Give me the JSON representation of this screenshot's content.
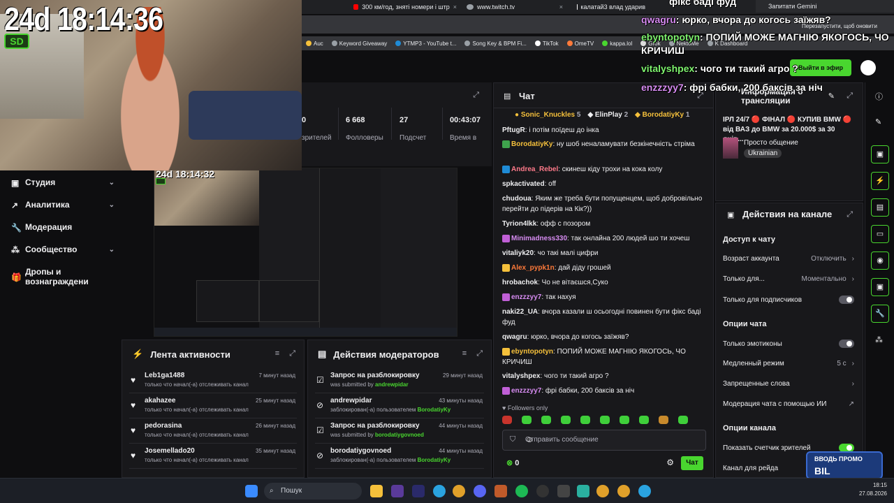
{
  "browser": {
    "tabs": [
      {
        "label": "300 км/год, зняті номери і штр",
        "color": "#ff0000"
      },
      {
        "label": "www.twitch.tv",
        "color": "#9aa0a6"
      },
      {
        "label": "калатай3 влад ударив",
        "color": "#ffffff"
      }
    ],
    "tab_close": "×",
    "win_buttons": [
      "—",
      "❐",
      "✕"
    ],
    "gemini": "Запитати Gemini",
    "restart": "Перезапустити, щоб оновити",
    "bookmarks": [
      "Auc",
      "Keyword Giveaway",
      "YTMP3 - YouTube t...",
      "Song Key & BPM Fi...",
      "TikTok",
      "OmeTV",
      "kappa.lol",
      "Grok",
      "NektoMe",
      "K Dashboard"
    ]
  },
  "stream": {
    "timer": "24d 18:14:36",
    "badge": "SD",
    "preview_timer": "24d 18:14:32"
  },
  "stats": {
    "items": [
      {
        "value": "0",
        "label": "зрителей"
      },
      {
        "value": "6 668",
        "label": "Фолловеры"
      },
      {
        "value": "27",
        "label": "Подсчет"
      },
      {
        "value": "00:43:07",
        "label": "Время в"
      }
    ]
  },
  "sidebar": {
    "items": [
      {
        "label": "Студия",
        "chevron": "⌄"
      },
      {
        "label": "Аналитика",
        "chevron": "⌄"
      },
      {
        "label": "Модерация",
        "chevron": ""
      },
      {
        "label": "Сообщество",
        "chevron": "⌄"
      },
      {
        "label": "Дропы и вознаграждени",
        "chevron": ""
      }
    ]
  },
  "activity": {
    "title": "Лента активности",
    "rows": [
      {
        "name": "Leb1ga1488",
        "sub": "только что начал(-а) отслеживать канал",
        "time": "7 минут назад"
      },
      {
        "name": "akahazee",
        "sub": "только что начал(-а) отслеживать канал",
        "time": "25 минут назад"
      },
      {
        "name": "pedorasina",
        "sub": "только что начал(-а) отслеживать канал",
        "time": "26 минут назад"
      },
      {
        "name": "Josemellado20",
        "sub": "только что начал(-а) отслеживать канал",
        "time": "35 минут назад"
      }
    ]
  },
  "modactions": {
    "title": "Действия модераторов",
    "rows": [
      {
        "name": "Запрос на разблокировку",
        "sub_prefix": "was submitted by",
        "sub_user": "andrewpidar",
        "time": "29 минут назад"
      },
      {
        "name": "andrewpidar",
        "sub_prefix": "заблокирован(-а) пользователем",
        "sub_user": "BorodatiyKy",
        "time": "43 минуты назад"
      },
      {
        "name": "Запрос на разблокировку",
        "sub_prefix": "was submitted by",
        "sub_user": "borodatiygovnoed",
        "time": "44 минуты назад"
      },
      {
        "name": "borodatiygovnoed",
        "sub_prefix": "заблокирован(-а) пользователем",
        "sub_user": "BorodatiyKy",
        "time": "44 минуты назад"
      }
    ]
  },
  "chat": {
    "title": "Чат",
    "gifters": [
      {
        "name": "Sonic_Knuckles",
        "count": "5",
        "color": "#f5c03b"
      },
      {
        "name": "ElinPlay",
        "count": "2",
        "color": "#efeff1"
      },
      {
        "name": "BorodatiyKy",
        "count": "1",
        "color": "#f5c03b"
      }
    ],
    "messages": [
      {
        "user": "PftugR",
        "color": "#efeff1",
        "text": ": і потім поїдеш до інка",
        "badge": ""
      },
      {
        "user": "BorodatiyKy",
        "color": "#f5c03b",
        "text": ": ну шоб неналамувати безкінечність стріма",
        "badge": "#3fa34d"
      },
      {
        "user": "Andrea_Rebel",
        "color": "#ff7a8a",
        "text": ": скинеш кіду трохи на кока колу",
        "badge": "#1f8bd6"
      },
      {
        "user": "spkactivated",
        "color": "#efeff1",
        "text": ": off",
        "badge": ""
      },
      {
        "user": "chudoua",
        "color": "#efeff1",
        "text": ": Яким же треба бути попущенцем, щоб добровільно перейти до підерів на Кік?))",
        "badge": ""
      },
      {
        "user": "Tyrion4lkk",
        "color": "#efeff1",
        "text": ": офф с позором",
        "badge": ""
      },
      {
        "user": "Minimadness330",
        "color": "#d78cf2",
        "text": ": так онлайна 200 людей шо ти хочеш",
        "badge": "#c05fd6"
      },
      {
        "user": "vitaliyk20",
        "color": "#efeff1",
        "text": ": чо такі малі цифри",
        "badge": ""
      },
      {
        "user": "Alex_pypk1n",
        "color": "#ff7a3a",
        "text": ": дай діду грошей",
        "badge": "#f5c03b"
      },
      {
        "user": "hrobachok",
        "color": "#efeff1",
        "text": ": Чо не вітаєшся,Суко",
        "badge": ""
      },
      {
        "user": "enzzzyy7",
        "color": "#d78cf2",
        "text": ": так нахуя",
        "badge": "#c05fd6"
      },
      {
        "user": "naki22_UA",
        "color": "#efeff1",
        "text": ": вчора казали ш осьогодні повинен бути фікс баді фуд",
        "badge": ""
      },
      {
        "user": "qwagru",
        "color": "#efeff1",
        "text": ": юрко, вчора до когось заїжяв?",
        "badge": ""
      },
      {
        "user": "ebyntopotyn",
        "color": "#f5c03b",
        "text": ": ПОПИЙ МОЖЕ МАГНІЮ ЯКОГОСЬ, ЧО КРИЧИШ",
        "badge": "#f5c03b"
      },
      {
        "user": "vitalyshpex",
        "color": "#efeff1",
        "text": ": чого ти такий агро ?",
        "badge": ""
      },
      {
        "user": "enzzzyy7",
        "color": "#d78cf2",
        "text": ": фрі бабки, 200 баксів за ніч",
        "badge": "#c05fd6"
      }
    ],
    "followers_only": "Followers only",
    "placeholder": "Отправить сообщение",
    "points": "0",
    "send": "Чат"
  },
  "overlay": [
    {
      "user": "",
      "text": "фікс баді фуд",
      "user_color": "#7ff36f"
    },
    {
      "user": "qwagru",
      "text": ": юрко, вчора до когось заїжяв?",
      "user_color": "#d78cf2"
    },
    {
      "user": "ebyntopotyn",
      "text": ": ПОПИЙ МОЖЕ МАГНІЮ ЯКОГОСЬ, ЧО",
      "user_color": "#7ff36f"
    },
    {
      "user": "",
      "text": "КРИЧИШ",
      "user_color": "#7ff36f"
    },
    {
      "user": "vitalyshpex",
      "text": ": чого ти такий агро ?",
      "user_color": "#7ff36f"
    },
    {
      "user": "enzzzyy7",
      "text": ": фрі бабки, 200 баксів за ніч",
      "user_color": "#d78cf2"
    }
  ],
  "go_live": "Выйти в эфир",
  "info": {
    "title": "Информация о трансляции",
    "stream_title": "ІРЛ 24/7 🔴 ФІНАЛ 🔴 КУПИВ BMW 🔴 від ВАЗ до BMW за 20.000$ за 30 днів...",
    "category": "Просто общение",
    "tag": "Ukrainian"
  },
  "channel": {
    "title": "Действия на канале",
    "chat_access": "Доступ к чату",
    "account_age": "Возраст аккаунта",
    "account_age_val": "Отключить",
    "only_for": "Только для...",
    "only_for_val": "Моментально",
    "subs_only": "Только для подписчиков",
    "chat_options": "Опции чата",
    "emotes_only": "Только эмотиконы",
    "slow_mode": "Медленный режим",
    "slow_mode_val": "5 с",
    "banned_words": "Запрещенные слова",
    "ai_mod": "Модерация чата с помощью ИИ",
    "channel_options": "Опции канала",
    "viewer_count": "Показать счетчик зрителей",
    "raid": "Канал для рейда"
  },
  "taskbar": {
    "search": "Пошук",
    "time": "18:15",
    "date": "27.08.2026"
  },
  "promo": {
    "line1": "ВВОДЬ ПРОМО",
    "line2": "BIL"
  }
}
